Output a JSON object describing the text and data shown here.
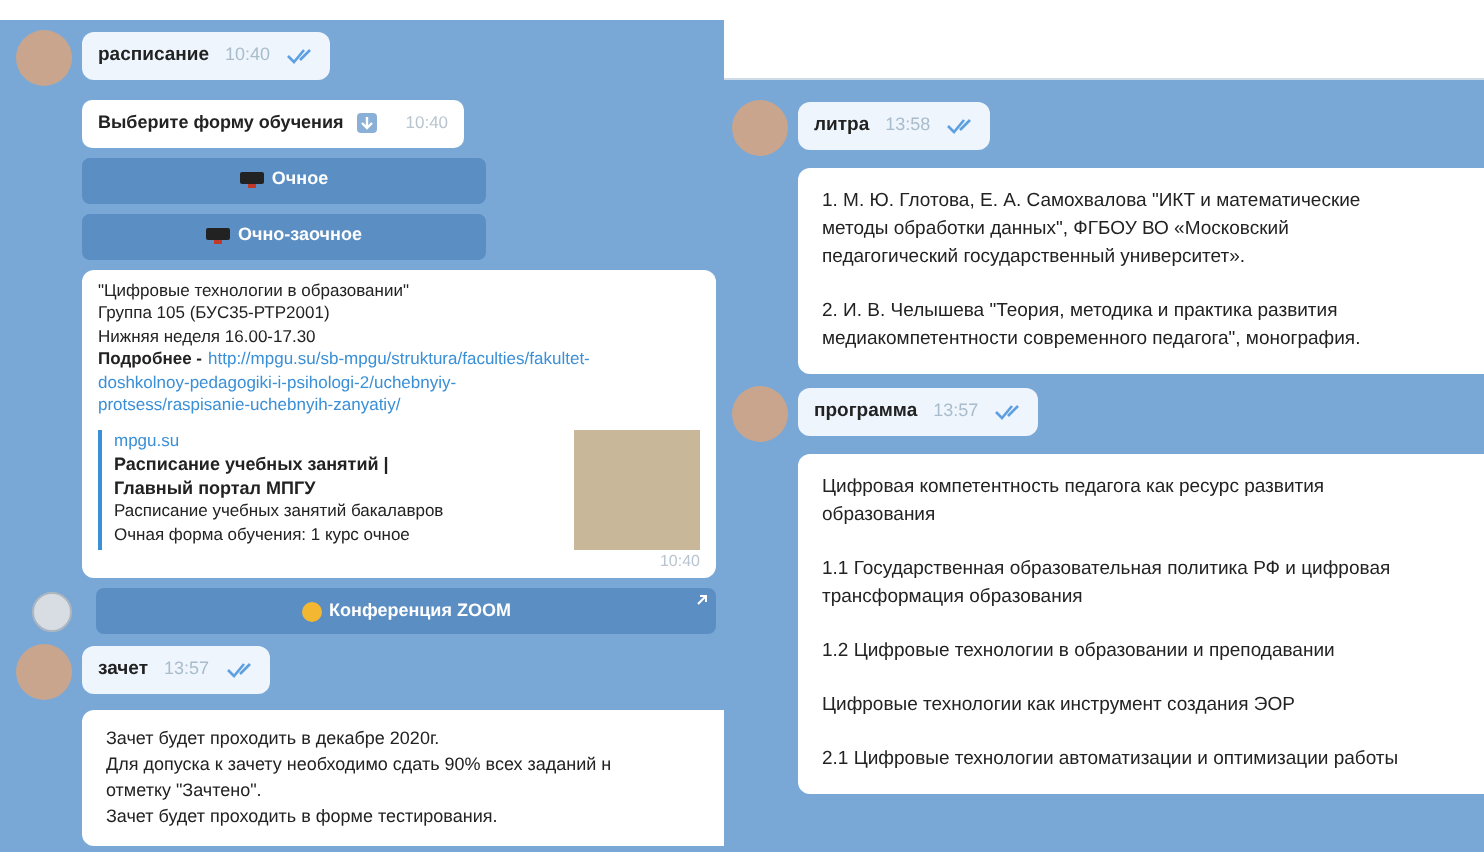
{
  "left_chat": {
    "messages": [
      {
        "kind": "command",
        "text": "расписание",
        "time": "10:40",
        "read": true
      },
      {
        "kind": "reply",
        "text": "Выберите форму обучения",
        "time": "10:40"
      },
      {
        "kind": "button",
        "label": "Очное"
      },
      {
        "kind": "button",
        "label": "Очно-заочное"
      },
      {
        "kind": "schedule",
        "lines": [
          "\"Цифровые технологии в образовании\"",
          "Группа 105 (БУС35-РТР2001)",
          "Нижняя неделя 16.00-17.30"
        ],
        "more_label": "Подробнее -",
        "url_lines": [
          "http://mpgu.su/sb-mpgu/struktura/faculties/fakultet-",
          "doshkolnoy-pedagogiki-i-psihologi-2/uchebnyiy-",
          "protsess/raspisanie-uchebnyih-zanyatiy/"
        ],
        "preview": {
          "site": "mpgu.su",
          "title": "Расписание учебных занятий | Главный портал МПГУ",
          "description": "Расписание учебных занятий бакалавров",
          "note": "Очная форма обучения: 1 курс очное"
        },
        "time": "10:40"
      },
      {
        "kind": "bot_button",
        "label": "Конференция ZOOM"
      },
      {
        "kind": "command",
        "text": "зачет",
        "time": "13:57",
        "read": true
      },
      {
        "kind": "lines",
        "lines": [
          "Зачет будет проходить в декабре 2020г.",
          "Для допуска к зачету необходимо сдать 90% всех заданий н",
          "отметку \"Зачтено\".",
          "Зачет будет проходить в форме тестирования."
        ]
      }
    ]
  },
  "right_chat": {
    "messages": [
      {
        "kind": "command",
        "text": "литра",
        "time": "13:58",
        "read": true
      },
      {
        "kind": "paragraphs",
        "paragraphs": [
          "1. М. Ю. Глотова, Е. А. Самохвалова \"ИКТ и математические методы обработки данных\", ФГБОУ ВО «Московский педагогический государственный университет».",
          "2. И. В. Челышева  \"Теория, методика и практика развития медиакомпетентности современного педагога\", монография."
        ]
      },
      {
        "kind": "command",
        "text": "программа",
        "time": "13:57",
        "read": true
      },
      {
        "kind": "paragraphs",
        "paragraphs": [
          "Цифровая компетентность педагога как ресурс развития образования",
          "1.1 Государственная образовательная политика РФ и цифровая трансформация образования",
          "1.2 Цифровые технологии в образовании и преподавании",
          "Цифровые технологии как инструмент создания ЭОР",
          "2.1 Цифровые технологии автоматизации и оптимизации работы"
        ]
      }
    ]
  }
}
